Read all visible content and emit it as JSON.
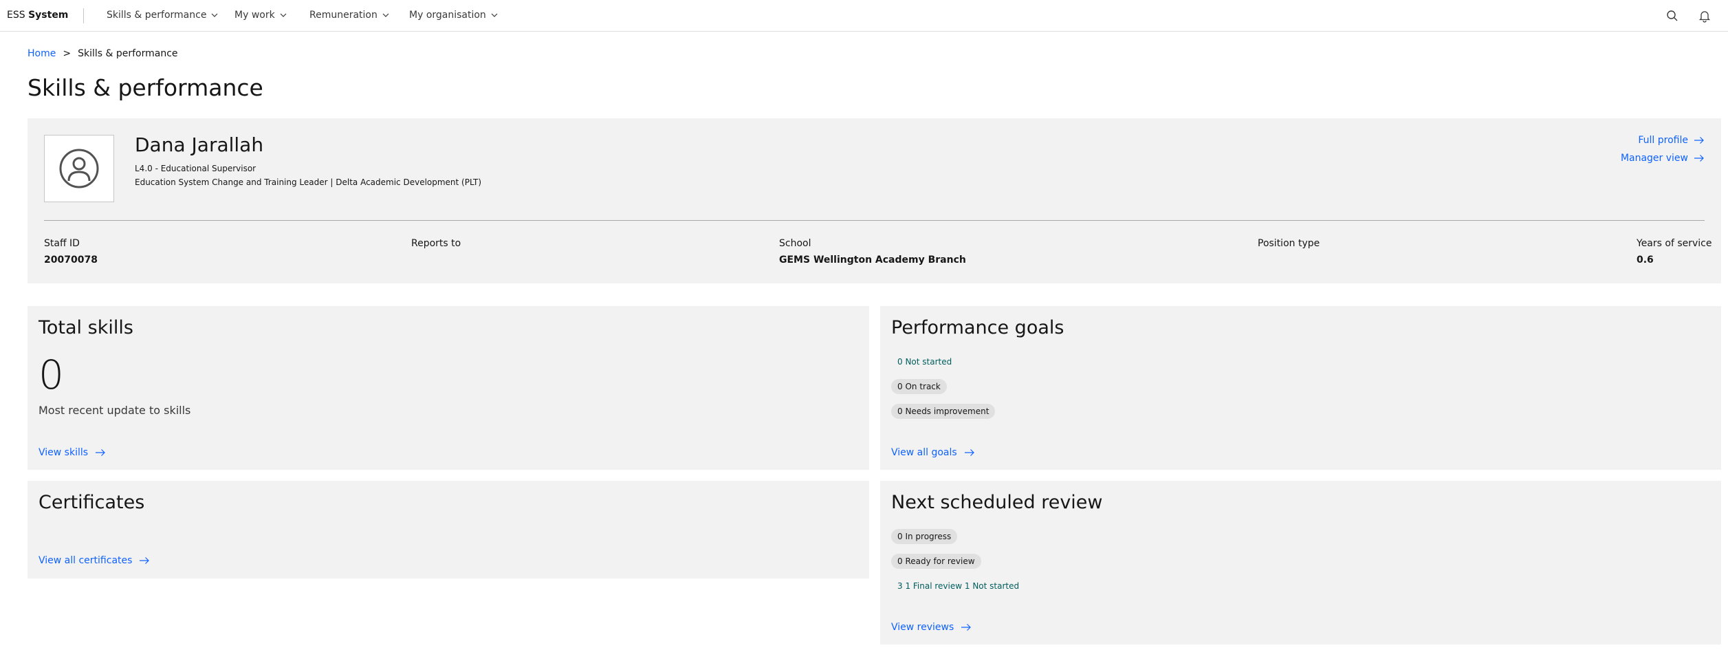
{
  "header": {
    "brand_prefix": "ESS",
    "brand_name": "System",
    "nav": [
      {
        "label": "Skills & performance"
      },
      {
        "label": "My work"
      },
      {
        "label": "Remuneration"
      },
      {
        "label": "My organisation"
      }
    ],
    "icons": [
      "search-icon",
      "notification-icon"
    ]
  },
  "breadcrumb": {
    "home": "Home",
    "separator": ">",
    "current": "Skills & performance"
  },
  "page_title": "Skills & performance",
  "profile": {
    "name": "Dana Jarallah",
    "grade": "L4.0 - Educational Supervisor",
    "position": "Education System Change and Training Leader | Delta Academic Development (PLT)",
    "links": {
      "full_profile": "Full profile",
      "manager_view": "Manager view"
    },
    "stats": {
      "staff_id_label": "Staff ID",
      "staff_id": "20070078",
      "reports_to_label": "Reports to",
      "reports_to": "",
      "school_label": "School",
      "school": "GEMS Wellington Academy Branch",
      "position_type_label": "Position type",
      "position_type": "",
      "years_label": "Years of service",
      "years": "0.6"
    }
  },
  "skills": {
    "title": "Total skills",
    "count": "0",
    "subtitle": "Most recent update to skills",
    "link": "View skills"
  },
  "goals": {
    "title": "Performance goals",
    "not_started": "0 Not started",
    "on_track": "0 On track",
    "needs_improvement": "0 Needs improvement",
    "link": "View all goals"
  },
  "certificates": {
    "title": "Certificates",
    "link": "View all certificates"
  },
  "review": {
    "title": "Next scheduled review",
    "in_progress": "0 In progress",
    "ready": "0 Ready for review",
    "final_line": "3 1 Final review 1 Not started",
    "link": "View reviews"
  },
  "colors": {
    "link": "#0f62fe",
    "tile_bg": "#f2f2f2",
    "tag_bg": "#e0e0e0",
    "teal_text": "#005d5d"
  }
}
